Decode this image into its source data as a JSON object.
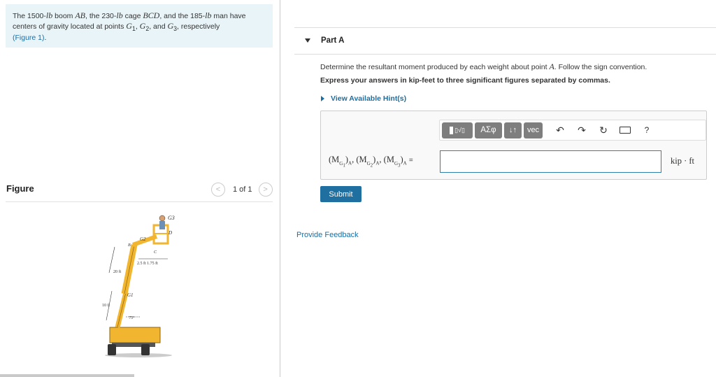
{
  "problem": {
    "text_1": "The 1500-",
    "unit_lb_1": "lb",
    "text_2": " boom ",
    "boom": "AB",
    "text_3": ", the 230-",
    "unit_lb_2": "lb",
    "text_4": " cage ",
    "cage": "BCD",
    "text_5": ", and the 185-",
    "unit_lb_3": "lb",
    "text_6": " man have centers of gravity located at points ",
    "g1": "G",
    "g1_sub": "1",
    "sep_1": ", ",
    "g2": "G",
    "g2_sub": "2",
    "sep_2": ", and ",
    "g3": "G",
    "g3_sub": "3",
    "text_7": ", respectively",
    "figure_link": "(Figure 1)",
    "period": "."
  },
  "figure": {
    "label": "Figure",
    "pager_text": "1 of 1",
    "prev": "<",
    "next": ">",
    "labels": {
      "g3": "G3",
      "g2": "G2",
      "g1": "G1",
      "b": "B",
      "c": "C",
      "d": "D",
      "dims": "2.5 ft 1.75 ft",
      "h20": "20 ft",
      "h10": "10 ft",
      "angle": "75°"
    }
  },
  "part": {
    "title": "Part A"
  },
  "question": {
    "text_1": "Determine the resultant moment produced by each weight about point ",
    "point": "A",
    "text_2": ". Follow the sign convention."
  },
  "instructions": "Express your answers in kip-feet to three significant figures separated by commas.",
  "hints_label": "View Available Hint(s)",
  "toolbar": {
    "greek": "ΑΣφ",
    "arrows": "↓↑",
    "vec": "vec",
    "help": "?"
  },
  "answer": {
    "m": "(M",
    "g": "G",
    "s1": "1",
    "s2": "2",
    "s3": "3",
    "close": ")",
    "a": "A",
    "comma": ", ",
    "equals": "=",
    "value": "",
    "unit": "kip · ft"
  },
  "submit_label": "Submit",
  "feedback_label": "Provide Feedback",
  "colors": {
    "accent": "#1f6fa0",
    "link": "#1a6fa3",
    "problem_bg": "#e8f4f8",
    "toolbar_btn": "#7e7e7e",
    "machine": "#f2b530"
  }
}
